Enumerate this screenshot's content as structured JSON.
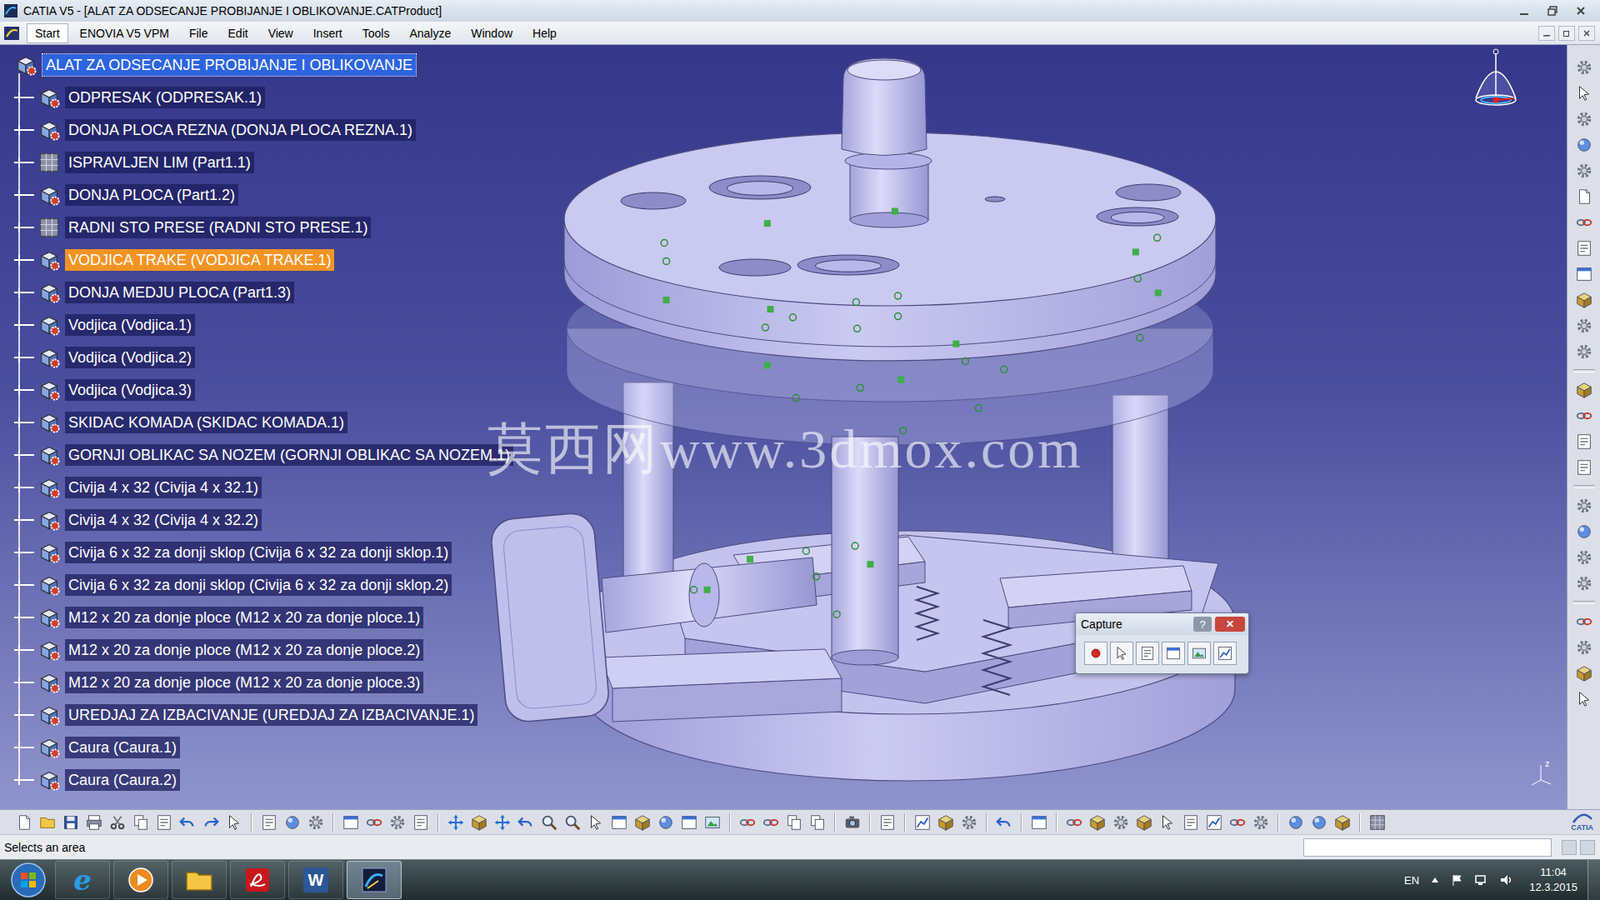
{
  "window": {
    "title": "CATIA V5 - [ALAT ZA ODSECANJE PROBIJANJE I OBLIKOVANJE.CATProduct]"
  },
  "menu": [
    {
      "label": "Start",
      "selected": true
    },
    {
      "label": "ENOVIA V5 VPM",
      "selected": false
    },
    {
      "label": "File",
      "selected": false
    },
    {
      "label": "Edit",
      "selected": false
    },
    {
      "label": "View",
      "selected": false
    },
    {
      "label": "Insert",
      "selected": false
    },
    {
      "label": "Tools",
      "selected": false
    },
    {
      "label": "Analyze",
      "selected": false
    },
    {
      "label": "Window",
      "selected": false
    },
    {
      "label": "Help",
      "selected": false
    }
  ],
  "tree": {
    "items": [
      {
        "label": "ALAT ZA ODSECANJE PROBIJANJE I OBLIKOVANJE",
        "kind": "root",
        "selected": true,
        "highlighted": false,
        "expanded": true
      },
      {
        "label": "ODPRESAK (ODPRESAK.1)",
        "kind": "product",
        "selected": false,
        "highlighted": false,
        "expanded": false
      },
      {
        "label": "DONJA PLOCA REZNA (DONJA PLOCA REZNA.1)",
        "kind": "product",
        "selected": false,
        "highlighted": false,
        "expanded": false
      },
      {
        "label": "ISPRAVLJEN LIM (Part1.1)",
        "kind": "part",
        "selected": false,
        "highlighted": false,
        "expanded": false
      },
      {
        "label": "DONJA PLOCA (Part1.2)",
        "kind": "product",
        "selected": false,
        "highlighted": false,
        "expanded": false
      },
      {
        "label": "RADNI STO PRESE (RADNI STO PRESE.1)",
        "kind": "part",
        "selected": false,
        "highlighted": false,
        "expanded": false
      },
      {
        "label": "VODJICA TRAKE (VODJICA TRAKE.1)",
        "kind": "product",
        "selected": false,
        "highlighted": true,
        "expanded": false
      },
      {
        "label": "DONJA MEDJU PLOCA (Part1.3)",
        "kind": "product",
        "selected": false,
        "highlighted": false,
        "expanded": false
      },
      {
        "label": "Vodjica (Vodjica.1)",
        "kind": "product",
        "selected": false,
        "highlighted": false,
        "expanded": false
      },
      {
        "label": "Vodjica (Vodjica.2)",
        "kind": "product",
        "selected": false,
        "highlighted": false,
        "expanded": false
      },
      {
        "label": "Vodjica (Vodjica.3)",
        "kind": "product",
        "selected": false,
        "highlighted": false,
        "expanded": false
      },
      {
        "label": "SKIDAC KOMADA (SKIDAC KOMADA.1)",
        "kind": "product",
        "selected": false,
        "highlighted": false,
        "expanded": false
      },
      {
        "label": "GORNJI OBLIKAC SA NOZEM (GORNJI OBLIKAC SA NOZEM.1)",
        "kind": "product",
        "selected": false,
        "highlighted": false,
        "expanded": false
      },
      {
        "label": "Civija 4 x 32 (Civija 4 x 32.1)",
        "kind": "product",
        "selected": false,
        "highlighted": false,
        "expanded": false
      },
      {
        "label": "Civija 4 x 32 (Civija 4 x 32.2)",
        "kind": "product",
        "selected": false,
        "highlighted": false,
        "expanded": false
      },
      {
        "label": "Civija 6 x 32 za donji sklop (Civija 6 x 32 za donji sklop.1)",
        "kind": "product",
        "selected": false,
        "highlighted": false,
        "expanded": false
      },
      {
        "label": "Civija 6 x 32 za donji sklop (Civija 6 x 32 za donji sklop.2)",
        "kind": "product",
        "selected": false,
        "highlighted": false,
        "expanded": false
      },
      {
        "label": "M12 x 20 za donje ploce (M12 x 20 za donje ploce.1)",
        "kind": "product",
        "selected": false,
        "highlighted": false,
        "expanded": false
      },
      {
        "label": "M12 x 20 za donje ploce (M12 x 20 za donje ploce.2)",
        "kind": "product",
        "selected": false,
        "highlighted": false,
        "expanded": false
      },
      {
        "label": "M12 x 20 za donje ploce (M12 x 20 za donje ploce.3)",
        "kind": "product",
        "selected": false,
        "highlighted": false,
        "expanded": false
      },
      {
        "label": "UREDJAJ ZA IZBACIVANJE (UREDJAJ ZA IZBACIVANJE.1)",
        "kind": "product",
        "selected": false,
        "highlighted": false,
        "expanded": false
      },
      {
        "label": "Caura (Caura.1)",
        "kind": "product",
        "selected": false,
        "highlighted": false,
        "expanded": false
      },
      {
        "label": "Caura (Caura.2)",
        "kind": "product",
        "selected": false,
        "highlighted": false,
        "expanded": false
      }
    ]
  },
  "viewer": {
    "watermark": "莫西网www.3dmox.com",
    "axis_label": "z"
  },
  "capture_dialog": {
    "title": "Capture",
    "help": "?",
    "close": "✕"
  },
  "status_bar": {
    "message": "Selects an area"
  },
  "brand": "CATIA",
  "taskbar": {
    "apps": [
      {
        "kind": "ie",
        "glyph": "e",
        "active": false
      },
      {
        "kind": "media",
        "active": false
      },
      {
        "kind": "explorer",
        "active": false
      },
      {
        "kind": "acrobat",
        "active": false
      },
      {
        "kind": "word",
        "glyph": "W",
        "active": false
      },
      {
        "kind": "catia",
        "active": true
      }
    ],
    "language": "EN",
    "time": "11:04",
    "date": "12.3.2015"
  }
}
